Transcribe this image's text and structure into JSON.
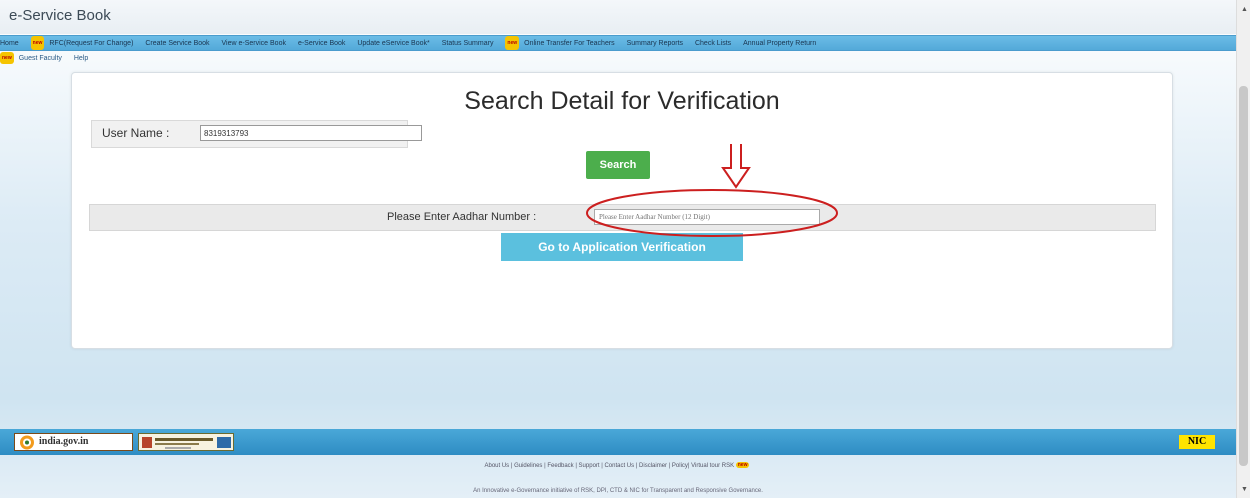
{
  "app": {
    "title": "e-Service Book"
  },
  "nav": {
    "row1": [
      {
        "label": "Home",
        "new": false
      },
      {
        "label": "RFC(Request For Change)",
        "new": true
      },
      {
        "label": "Create Service Book",
        "new": false
      },
      {
        "label": "View e-Service Book",
        "new": false
      },
      {
        "label": "e-Service Book",
        "new": false
      },
      {
        "label": "Update eService Book*",
        "new": false
      },
      {
        "label": "Status Summary",
        "new": false
      },
      {
        "label": "Online Transfer For Teachers",
        "new": true
      },
      {
        "label": "Summary Reports",
        "new": false
      },
      {
        "label": "Check Lists",
        "new": false
      },
      {
        "label": "Annual Property Return",
        "new": false
      }
    ],
    "row2": [
      {
        "label": "Guest Faculty",
        "new": true
      },
      {
        "label": "Help",
        "new": false
      }
    ],
    "new_badge": "new"
  },
  "form": {
    "heading": "Search Detail for Verification",
    "user_label": "User Name :",
    "user_value": "8319313793",
    "search_label": "Search",
    "aadhar_label": "Please Enter Aadhar Number :",
    "aadhar_placeholder": "Please Enter Aadhar Number (12 Digit)",
    "verify_label": "Go to Application Verification"
  },
  "footer": {
    "logo_india": "india.gov.in",
    "logo_nic": "NIC",
    "links_text": "About Us | Guidelines | Feedback | Support | Contact Us | Disclaimer | Policy| Virtual tour RSK",
    "tagline": "An Innovative e-Governance initiative of RSK, DPI, CTD & NIC for Transparent and Responsive Governance."
  },
  "colors": {
    "nav_bg": "#53a9d9",
    "search_button": "#4cae4c",
    "verify_button": "#5bc0de",
    "annotation_red": "#cc1f1f",
    "footer_bg": "#2e8cc3"
  }
}
